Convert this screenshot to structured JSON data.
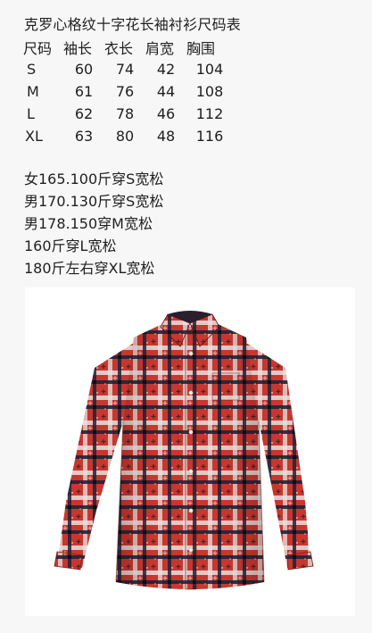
{
  "title": "克罗心格纹十字花长袖衬衫尺码表",
  "size_chart": {
    "headers": [
      "尺码",
      "袖长",
      "衣长",
      "肩宽",
      "胸围"
    ],
    "rows": [
      [
        "S",
        "60",
        "74",
        "42",
        "104"
      ],
      [
        "M",
        "61",
        "76",
        "44",
        "108"
      ],
      [
        "L",
        "62",
        "78",
        "46",
        "112"
      ],
      [
        "XL",
        "63",
        "80",
        "48",
        "116"
      ]
    ]
  },
  "recommendations": [
    "女165.100斤穿S宽松",
    "男170.130斤穿S宽松",
    "男178.150穿M宽松",
    "160斤穿L宽松",
    "180斤左右穿XL宽松"
  ],
  "product_image": {
    "subject": "red-plaid-cross-pattern-long-sleeve-shirt",
    "colors": {
      "base_red": "#c8372e",
      "dark_navy": "#1f2238",
      "white_check": "#e8e2e0",
      "background": "#ffffff"
    }
  }
}
